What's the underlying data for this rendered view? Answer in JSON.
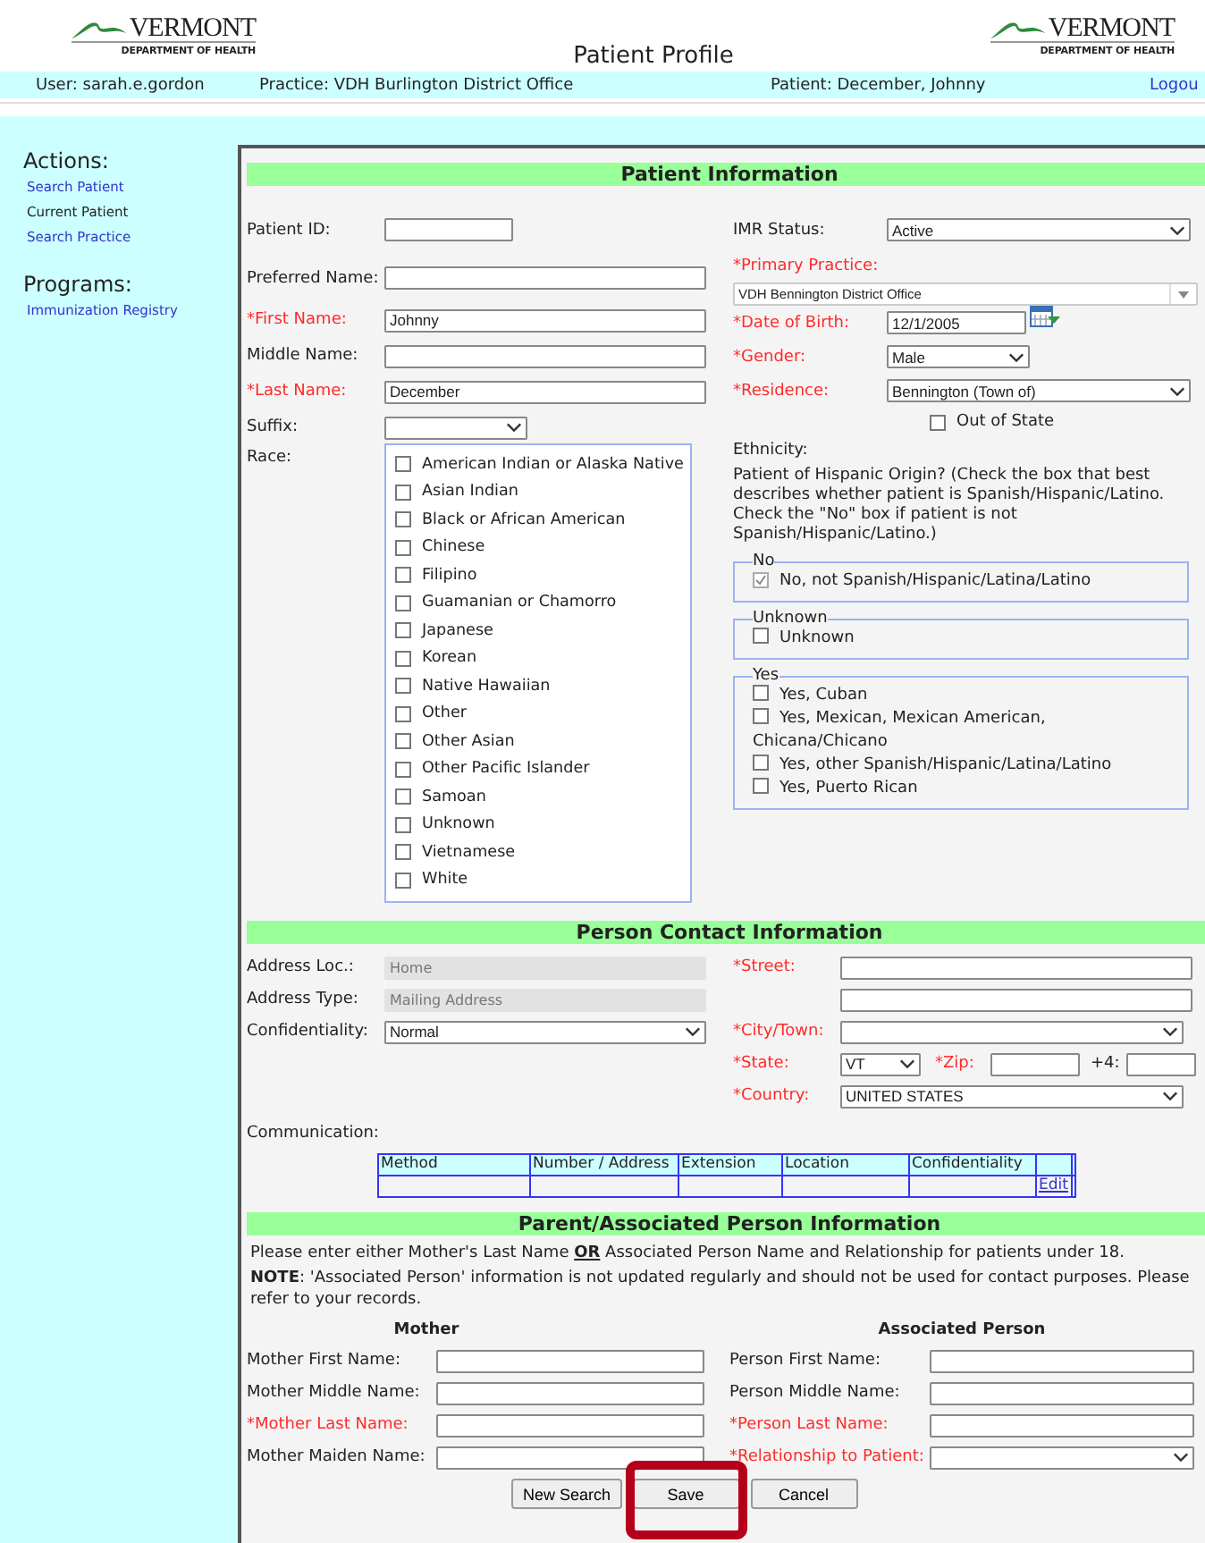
{
  "header": {
    "logos": [
      {
        "name": "VERMONT",
        "subtitle": "DEPARTMENT OF HEALTH"
      },
      {
        "name": "VERMONT",
        "subtitle": "DEPARTMENT OF HEALTH"
      }
    ],
    "title": "Patient Profile"
  },
  "user_bar": {
    "user": "User: sarah.e.gordon",
    "practice": "Practice: VDH Burlington District Office",
    "patient": "Patient: December, Johnny",
    "logout": "Logou"
  },
  "sidebar": {
    "sections": [
      {
        "title": "Actions:",
        "items": [
          {
            "label": "Search Patient",
            "selected": false
          },
          {
            "label": "Current Patient",
            "selected": true
          },
          {
            "label": "Search Practice",
            "selected": false
          }
        ]
      },
      {
        "title": "Programs:",
        "items": [
          {
            "label": "Immunization Registry",
            "selected": false
          }
        ]
      }
    ]
  },
  "patient_info": {
    "title": "Patient Information",
    "left_fields": [
      {
        "label": "Patient ID:",
        "required": false,
        "kind": "shorttext"
      },
      {
        "label": "Preferred Name:",
        "required": false,
        "kind": "text"
      },
      {
        "label": "*First Name:",
        "required": true,
        "kind": "text",
        "value": "Johnny"
      },
      {
        "label": "Middle Name:",
        "required": false,
        "kind": "text"
      },
      {
        "label": "*Last Name:",
        "required": true,
        "kind": "text",
        "value": "December"
      },
      {
        "label": "Suffix:",
        "required": false,
        "kind": "shortselect"
      }
    ],
    "race": {
      "label": "Race:",
      "options": [
        {
          "label": "American Indian or Alaska Native",
          "checked": false
        },
        {
          "label": "Asian Indian",
          "checked": false
        },
        {
          "label": "Black or African American",
          "checked": false
        },
        {
          "label": "Chinese",
          "checked": false
        },
        {
          "label": "Filipino",
          "checked": false
        },
        {
          "label": "Guamanian or Chamorro",
          "checked": false
        },
        {
          "label": "Japanese",
          "checked": false
        },
        {
          "label": "Korean",
          "checked": false
        },
        {
          "label": "Native Hawaiian",
          "checked": false
        },
        {
          "label": "Other",
          "checked": false
        },
        {
          "label": "Other Asian",
          "checked": false
        },
        {
          "label": "Other Pacific Islander",
          "checked": false
        },
        {
          "label": "Samoan",
          "checked": false
        },
        {
          "label": "Unknown",
          "checked": false
        },
        {
          "label": "Vietnamese",
          "checked": false
        },
        {
          "label": "White",
          "checked": false
        }
      ]
    },
    "right_fields": [
      {
        "label": "IMR Status:",
        "required": false,
        "kind": "select",
        "value": "Active"
      },
      {
        "label": "*Primary Practice:",
        "required": true,
        "kind": "combo",
        "value": "VDH Bennington District Office"
      },
      {
        "label": "*Date of Birth:",
        "required": true,
        "kind": "date",
        "value": "12/1/2005"
      },
      {
        "label": "*Gender:",
        "required": true,
        "kind": "shortselect",
        "value": "Male"
      },
      {
        "label": "*Residence:",
        "required": true,
        "kind": "select",
        "value": "Bennington (Town of)"
      },
      {
        "label": "Out of State",
        "kind": "checkbox",
        "checked": false
      }
    ],
    "ethnicity": {
      "label": "Ethnicity:",
      "description": "Patient of Hispanic Origin? (Check the box that best describes whether patient is Spanish/Hispanic/Latino. Check the \"No\" box if patient is not Spanish/Hispanic/Latino.)",
      "groups": [
        {
          "legend": "No",
          "options": [
            {
              "label": "No, not Spanish/Hispanic/Latina/Latino",
              "checked": true
            }
          ]
        },
        {
          "legend": "Unknown",
          "options": [
            {
              "label": "Unknown",
              "checked": false
            }
          ]
        },
        {
          "legend": "Yes",
          "options": [
            {
              "label": "Yes, Cuban",
              "checked": false
            },
            {
              "label": "Yes, Mexican, Mexican American, Chicana/Chicano",
              "checked": false
            },
            {
              "label": "Yes, other Spanish/Hispanic/Latina/Latino",
              "checked": false
            },
            {
              "label": "Yes, Puerto Rican",
              "checked": false
            }
          ]
        }
      ]
    }
  },
  "contact": {
    "title": "Person Contact Information",
    "left_fields": [
      {
        "label": "Address Loc.:",
        "required": false,
        "kind": "readonly",
        "value": "Home"
      },
      {
        "label": "Address Type:",
        "required": false,
        "kind": "readonly",
        "value": "Mailing Address"
      },
      {
        "label": "Confidentiality:",
        "required": false,
        "kind": "select",
        "value": "Normal"
      }
    ],
    "right_fields": [
      {
        "label": "*Street:",
        "required": true,
        "kind": "text"
      },
      {
        "kind": "text"
      },
      {
        "label": "*City/Town:",
        "required": true,
        "kind": "select"
      },
      {
        "label": "*State:",
        "required": true,
        "kind": "statezip",
        "value": "VT",
        "zip_label": "*Zip:",
        "plus4_label": "+4:"
      },
      {
        "label": "*Country:",
        "required": true,
        "kind": "select",
        "value": "UNITED STATES"
      }
    ],
    "communication": {
      "label": "Communication:",
      "columns": [
        "Method",
        "Number / Address",
        "Extension",
        "Location",
        "Confidentiality"
      ],
      "rows": [
        {
          "action": "Edit"
        }
      ]
    }
  },
  "parent": {
    "title": "Parent/Associated Person Information",
    "instructions": "Please enter either Mother's Last Name **OR** Associated Person Name and Relationship for patients under 18.",
    "note": "**NOTE**: 'Associated Person' information is not updated regularly and should not be used for contact purposes. Please refer to your records.",
    "columns": [
      {
        "heading": "Mother",
        "fields": [
          {
            "label": "Mother First Name:",
            "required": false,
            "kind": "text"
          },
          {
            "label": "Mother Middle Name:",
            "required": false,
            "kind": "text"
          },
          {
            "label": "*Mother Last Name:",
            "required": true,
            "kind": "text"
          },
          {
            "label": "Mother Maiden Name:",
            "required": false,
            "kind": "text"
          }
        ]
      },
      {
        "heading": "Associated Person",
        "fields": [
          {
            "label": "Person First Name:",
            "required": false,
            "kind": "text"
          },
          {
            "label": "Person Middle Name:",
            "required": false,
            "kind": "text"
          },
          {
            "label": "*Person Last Name:",
            "required": true,
            "kind": "text"
          },
          {
            "label": "*Relationship to Patient:",
            "required": true,
            "kind": "select"
          }
        ]
      }
    ]
  },
  "buttons": [
    {
      "label": "New Search",
      "highlighted": false
    },
    {
      "label": "Save",
      "highlighted": true
    },
    {
      "label": "Cancel",
      "highlighted": false
    }
  ]
}
